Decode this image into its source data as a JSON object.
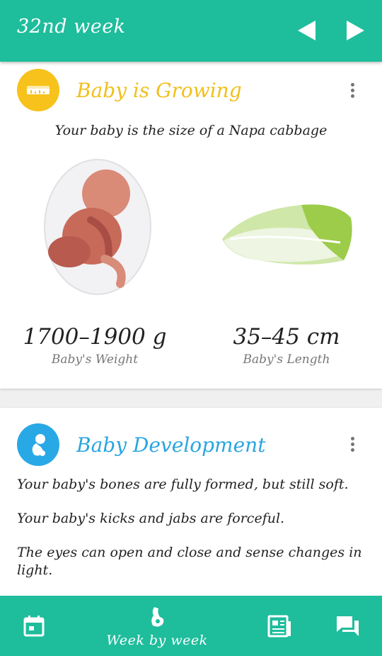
{
  "header": {
    "title": "32nd week"
  },
  "growing_card": {
    "title": "Baby is Growing",
    "size_text": "Your baby is the size of a Napa cabbage",
    "weight_value": "1700–1900 g",
    "weight_label": "Baby's Weight",
    "length_value": "35–45 cm",
    "length_label": "Baby's Length"
  },
  "development_card": {
    "title": "Baby Development",
    "lines": [
      "Your baby's bones are fully formed, but still soft.",
      "Your baby's kicks and jabs are forceful.",
      "The eyes can open and close and sense changes in light."
    ]
  },
  "bottom_nav": {
    "week_label": "Week by week"
  },
  "colors": {
    "primary": "#1ebd9c",
    "growing_accent": "#f7c21b",
    "development_accent": "#29a8e6"
  },
  "icons": {
    "prev": "triangle-left-icon",
    "next": "triangle-right-icon",
    "growing": "measuring-tape-icon",
    "development": "fetus-icon",
    "calendar": "calendar-icon",
    "week": "pregnancy-icon",
    "news": "newspaper-icon",
    "chat": "chat-bubbles-icon"
  }
}
